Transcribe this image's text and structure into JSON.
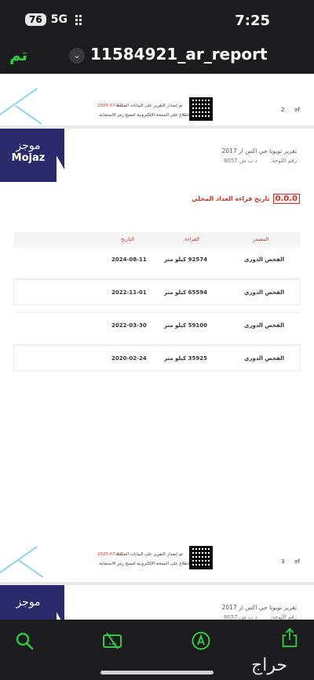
{
  "status": {
    "battery": "76",
    "network": "5G",
    "time": "7:25"
  },
  "nav": {
    "done_label": "تم",
    "title": "11584921_ar_report"
  },
  "page_footer": {
    "date": "2025-07-12",
    "line1": "تم إصدار التقرير على البيانات المتاحة",
    "line2": "للاطلاع على النسخة الإلكترونية امسح رمز الاستجابة.",
    "of_label": "of",
    "page_prev": "2",
    "page_next": "3"
  },
  "report": {
    "logo_ar": "موجز",
    "logo_en": "Mojaz",
    "title": "تقرير تويوتا جي اكس ار 2017",
    "plate_label": "رقم اللوحة:",
    "plate_value": "د ب س 8057",
    "section_badge": "0.0.0",
    "section_title": "تاريخ قراءة العداد المحلي",
    "table": {
      "headers": {
        "source": "المصدر",
        "reading": "القراءة",
        "date": "التاريخ"
      },
      "rows": [
        {
          "source": "الفحص الدوري",
          "reading": "92574 كيلو متر",
          "date": "2024-08-11"
        },
        {
          "source": "الفحص الدوري",
          "reading": "65594 كيلو متر",
          "date": "2022-11-01"
        },
        {
          "source": "الفحص الدوري",
          "reading": "59100 كيلو متر",
          "date": "2022-03-30"
        },
        {
          "source": "الفحص الدوري",
          "reading": "35925 كيلو متر",
          "date": "2020-02-24"
        }
      ]
    }
  },
  "toolbar": {
    "icons": [
      "search-icon",
      "scan-icon",
      "markup-icon",
      "share-icon"
    ],
    "accent": "#2ecc40"
  },
  "watermark": "حراج"
}
